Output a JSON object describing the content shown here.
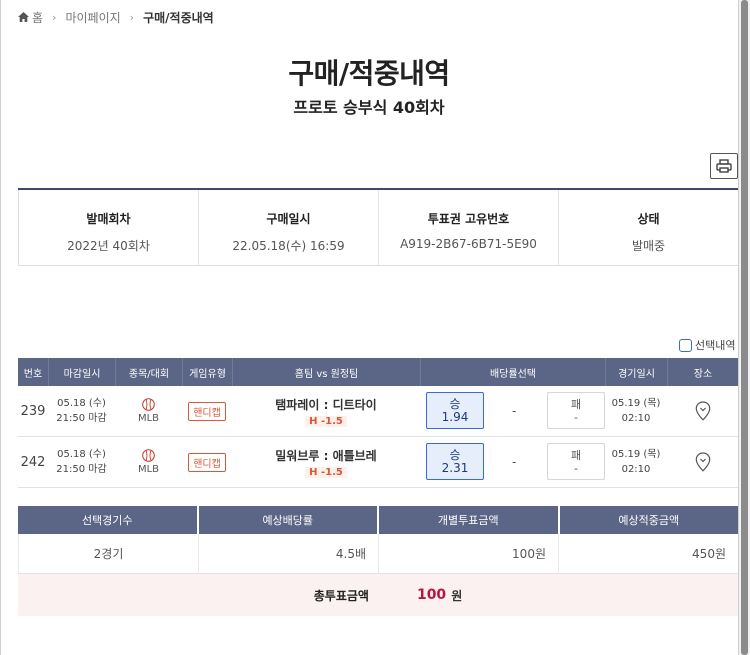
{
  "breadcrumb": {
    "home": "홈",
    "mypage": "마이페이지",
    "current": "구매/적중내역"
  },
  "page": {
    "title": "구매/적중내역",
    "subtitle": "프로토 승부식 40회차"
  },
  "info": {
    "round_label": "발매회차",
    "round_value": "2022년 40회차",
    "date_label": "구매일시",
    "date_value": "22.05.18(수) 16:59",
    "ticket_label": "투표권 고유번호",
    "ticket_value": "A919-2B67-6B71-5E90",
    "status_label": "상태",
    "status_value": "발매중"
  },
  "select_toggle": "선택내역",
  "games": {
    "headers": [
      "번호",
      "마감일시",
      "종목/대회",
      "게임유형",
      "홈팀 vs 원정팀",
      "배당률선택",
      "경기일시",
      "장소"
    ],
    "rows": [
      {
        "no": "239",
        "deadline_date": "05.18 (수)",
        "deadline_time": "21:50 마감",
        "sport": "MLB",
        "type": "핸디캡",
        "teams": "탬파레이 : 디트타이",
        "handicap": "H -1.5",
        "win_label": "승",
        "win_odds": "1.94",
        "draw": "-",
        "lose_label": "패",
        "lose_odds": "-",
        "game_date": "05.19 (목)",
        "game_time": "02:10"
      },
      {
        "no": "242",
        "deadline_date": "05.18 (수)",
        "deadline_time": "21:50 마감",
        "sport": "MLB",
        "type": "핸디캡",
        "teams": "밀워브루 : 애틀브레",
        "handicap": "H -1.5",
        "win_label": "승",
        "win_odds": "2.31",
        "draw": "-",
        "lose_label": "패",
        "lose_odds": "-",
        "game_date": "05.19 (목)",
        "game_time": "02:10"
      }
    ]
  },
  "summary": {
    "headers": [
      "선택경기수",
      "예상배당률",
      "개별투표금액",
      "예상적중금액"
    ],
    "values": [
      "2경기",
      "4.5배",
      "100원",
      "450원"
    ],
    "total_label": "총투표금액",
    "total_amount": "100",
    "total_unit": "원"
  },
  "colors": {
    "header_bg": "#5b6585",
    "accent_red": "#b3193f",
    "handicap": "#d9583b",
    "selected_blue": "#3a6ad6"
  }
}
